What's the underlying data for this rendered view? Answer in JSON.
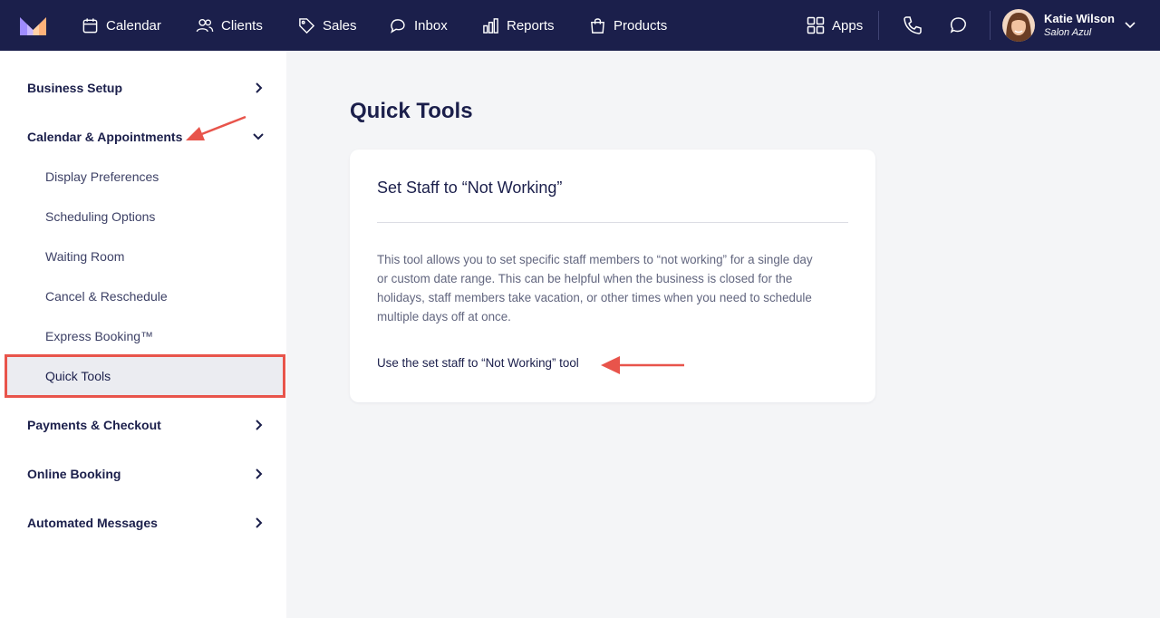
{
  "nav": {
    "items": [
      {
        "label": "Calendar",
        "icon": "calendar-icon"
      },
      {
        "label": "Clients",
        "icon": "users-icon"
      },
      {
        "label": "Sales",
        "icon": "tag-icon"
      },
      {
        "label": "Inbox",
        "icon": "chat-bubble-icon"
      },
      {
        "label": "Reports",
        "icon": "bar-chart-icon"
      },
      {
        "label": "Products",
        "icon": "shopping-bag-icon"
      }
    ],
    "apps_label": "Apps",
    "user": {
      "name": "Katie Wilson",
      "business": "Salon Azul"
    }
  },
  "sidebar": {
    "sections": [
      {
        "label": "Business Setup"
      },
      {
        "label": "Calendar & Appointments"
      },
      {
        "label": "Payments & Checkout"
      },
      {
        "label": "Online Booking"
      },
      {
        "label": "Automated Messages"
      }
    ],
    "sub_items": [
      {
        "label": "Display Preferences"
      },
      {
        "label": "Scheduling Options"
      },
      {
        "label": "Waiting Room"
      },
      {
        "label": "Cancel & Reschedule"
      },
      {
        "label": "Express Booking™"
      },
      {
        "label": "Quick Tools"
      }
    ]
  },
  "main": {
    "title": "Quick Tools",
    "card": {
      "title": "Set Staff to “Not Working”",
      "body": "This tool allows you to set specific staff members to “not working” for a single day or custom date range. This can be helpful when the business is closed for the holidays, staff members take vacation, or other times when you need to schedule multiple days off at once.",
      "link": "Use the set staff to “Not Working” tool"
    }
  },
  "colors": {
    "nav_bg": "#1b1f4b",
    "annotation": "#e8544b",
    "active_bg": "#ebecf1"
  }
}
